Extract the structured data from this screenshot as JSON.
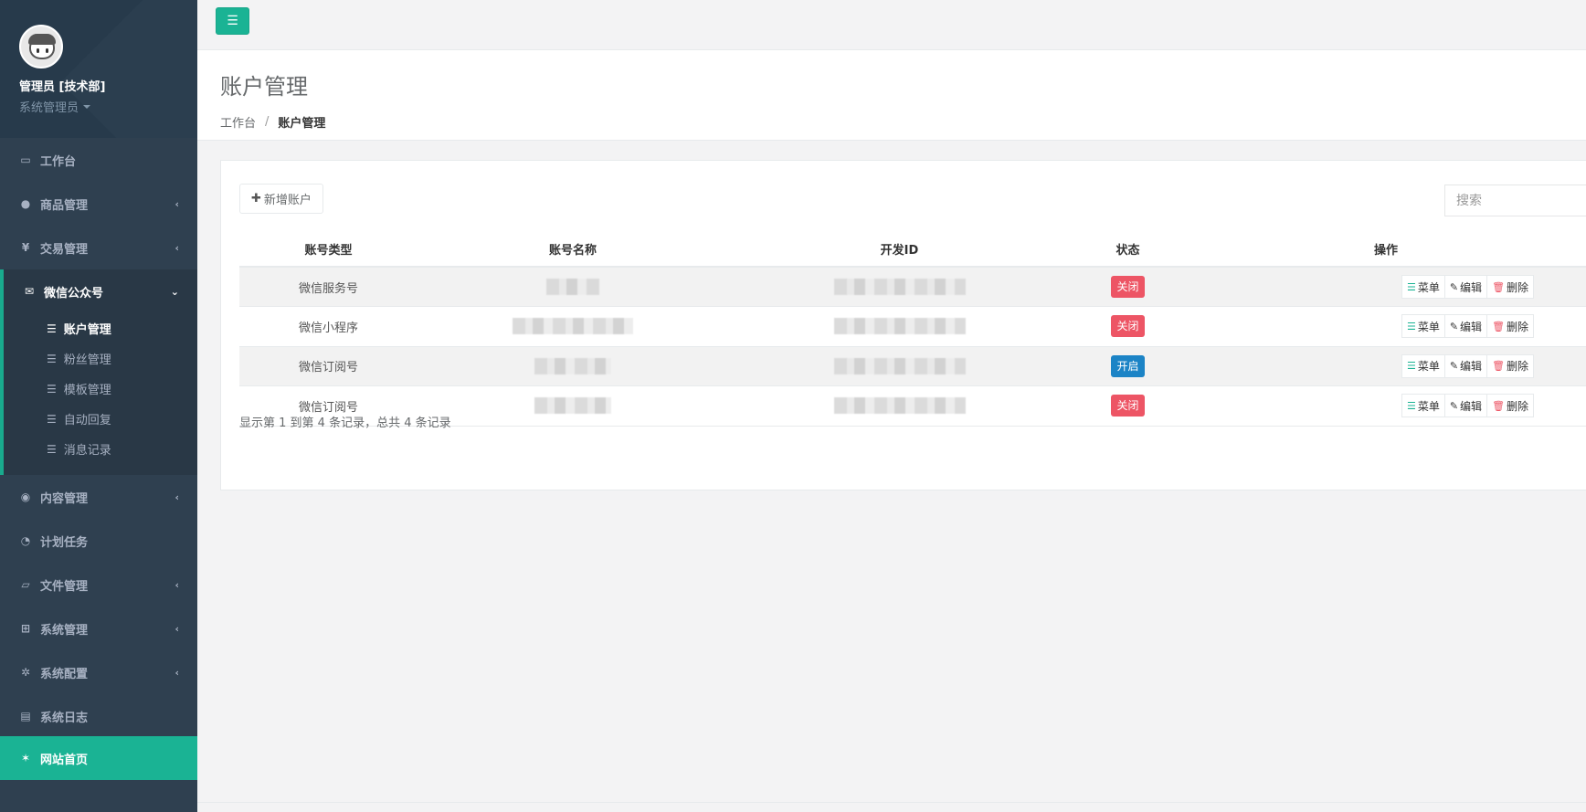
{
  "profile": {
    "name": "管理员 [技术部]",
    "role": "系统管理员"
  },
  "sidebar": {
    "items": [
      {
        "label": "工作台",
        "icon": "desktop-icon"
      },
      {
        "label": "商品管理",
        "icon": "apple-icon"
      },
      {
        "label": "交易管理",
        "icon": "yen-icon"
      },
      {
        "label": "微信公众号",
        "icon": "wechat-icon"
      },
      {
        "label": "内容管理",
        "icon": "chrome-icon"
      },
      {
        "label": "计划任务",
        "icon": "clock-icon"
      },
      {
        "label": "文件管理",
        "icon": "folder-icon"
      },
      {
        "label": "系统管理",
        "icon": "windows-icon"
      },
      {
        "label": "系统配置",
        "icon": "gear-icon"
      },
      {
        "label": "系统日志",
        "icon": "file-text-icon"
      },
      {
        "label": "网站首页",
        "icon": "home-star-icon"
      }
    ],
    "wechat_sub": [
      {
        "label": "账户管理"
      },
      {
        "label": "粉丝管理"
      },
      {
        "label": "模板管理"
      },
      {
        "label": "自动回复"
      },
      {
        "label": "消息记录"
      }
    ]
  },
  "header": {
    "title": "账户管理",
    "breadcrumb": [
      "工作台",
      "/",
      "账户管理"
    ]
  },
  "toolbar": {
    "add_label": "新增账户",
    "search_placeholder": "搜索"
  },
  "table": {
    "columns": [
      "账号类型",
      "账号名称",
      "开发ID",
      "状态",
      "操作"
    ],
    "rows": [
      {
        "type": "微信服务号",
        "status": "关闭"
      },
      {
        "type": "微信小程序",
        "status": "关闭"
      },
      {
        "type": "微信订阅号",
        "status": "开启"
      },
      {
        "type": "微信订阅号",
        "status": "关闭"
      }
    ],
    "actions": {
      "menu": "菜单",
      "edit": "编辑",
      "delete": "删除"
    }
  },
  "pager": {
    "info": "显示第 1 到第 4 条记录，总共 4 条记录"
  },
  "colors": {
    "sidebar_bg": "#2f4050",
    "accent": "#1ab394",
    "danger": "#ed5565",
    "primary": "#1c84c6"
  }
}
